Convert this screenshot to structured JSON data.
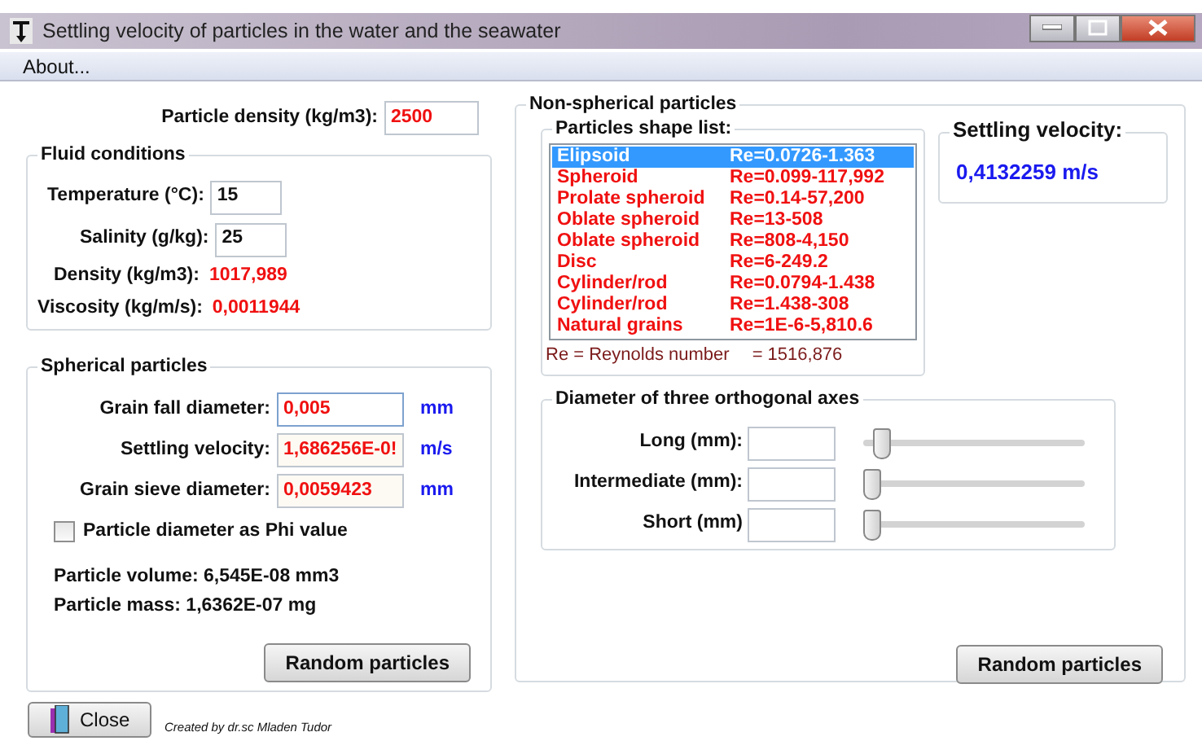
{
  "window": {
    "title": "Settling velocity of particles in the water and the seawater"
  },
  "menu": [
    "About..."
  ],
  "particle_density": {
    "label": "Particle density (kg/m3):",
    "value": "2500"
  },
  "fluid_conditions": {
    "title": "Fluid conditions",
    "fields": [
      {
        "kind": "input",
        "label": "Temperature (°C):",
        "value": "15"
      },
      {
        "kind": "input",
        "label": "Salinity (g/kg):",
        "value": "25"
      },
      {
        "kind": "output",
        "label": "Density (kg/m3):",
        "value": "1017,989"
      },
      {
        "kind": "output",
        "label": "Viscosity (kg/m/s):",
        "value": "0,0011944"
      }
    ]
  },
  "spherical_particles": {
    "title": "Spherical particles",
    "fields": [
      {
        "label": "Grain fall diameter:",
        "value": "0,005",
        "unit": "mm",
        "readonly": false
      },
      {
        "label": "Settling velocity:",
        "value": "1,686256E-0!",
        "unit": "m/s",
        "readonly": true
      },
      {
        "label": "Grain sieve diameter:",
        "value": "0,0059423",
        "unit": "mm",
        "readonly": true
      }
    ],
    "checkbox": {
      "label": "Particle diameter as Phi value",
      "checked": false
    },
    "info": [
      "Particle volume: 6,545E-08 mm3",
      "Particle mass: 1,6362E-07 mg"
    ],
    "button": "Random particles"
  },
  "non_spherical_particles": {
    "title": "Non-spherical particles",
    "shape_list": {
      "title": "Particles shape list:",
      "items": [
        {
          "name": "Elipsoid",
          "range": "Re=0.0726-1.363",
          "selected": true
        },
        {
          "name": "Spheroid",
          "range": "Re=0.099-117,992",
          "selected": false
        },
        {
          "name": "Prolate spheroid",
          "range": "Re=0.14-57,200",
          "selected": false
        },
        {
          "name": "Oblate spheroid",
          "range": "Re=13-508",
          "selected": false
        },
        {
          "name": "Oblate spheroid",
          "range": "Re=808-4,150",
          "selected": false
        },
        {
          "name": "Disc",
          "range": "Re=6-249.2",
          "selected": false
        },
        {
          "name": "Cylinder/rod",
          "range": "Re=0.0794-1.438",
          "selected": false
        },
        {
          "name": "Cylinder/rod",
          "range": "Re=1.438-308",
          "selected": false
        },
        {
          "name": "Natural grains",
          "range": "Re=1E-6-5,810.6",
          "selected": false
        }
      ],
      "legend": "Re = Reynolds number",
      "reynolds": "= 1516,876"
    },
    "settling_velocity": {
      "title": "Settling velocity:",
      "value": "0,4132259 m/s"
    },
    "axes": {
      "title": "Diameter of three orthogonal axes",
      "rows": [
        {
          "label": "Long (mm):",
          "level": 0.05
        },
        {
          "label": "Intermediate (mm):",
          "level": 0
        },
        {
          "label": "Short (mm)",
          "level": 0
        }
      ]
    },
    "button": "Random particles"
  },
  "close_button": "Close",
  "credit": "Created by dr.sc Mladen Tudor"
}
